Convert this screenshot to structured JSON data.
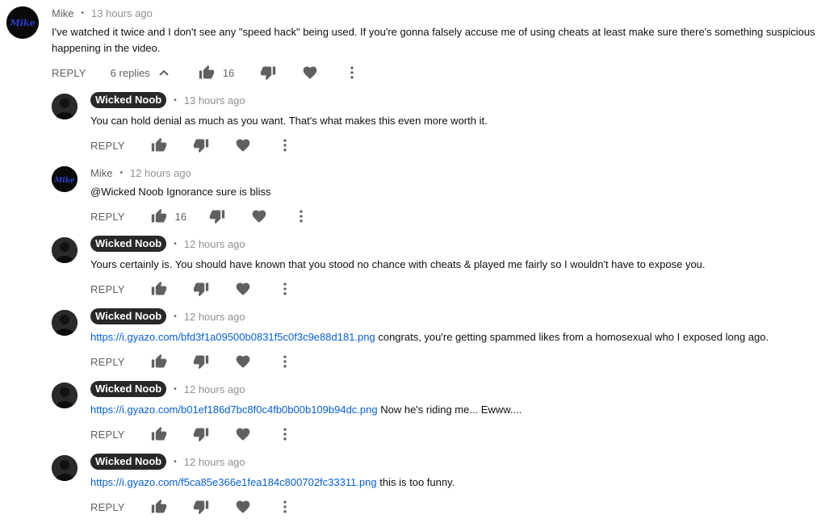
{
  "top_comment": {
    "author": "Mike",
    "time": "13 hours ago",
    "text": "I've watched it twice and I don't see any \"speed hack\" being used. If you're gonna falsely accuse me of using cheats at least make sure there's something suspicious happening in the video.",
    "reply_label": "REPLY",
    "replies_toggle": "6 replies",
    "likes": "16",
    "avatar_text": "Mike"
  },
  "replies": [
    {
      "author": "Wicked Noob",
      "time": "13 hours ago",
      "link": "",
      "text": "You can hold denial as much as you want. That's what makes this even more worth it.",
      "reply_label": "REPLY",
      "likes": ""
    },
    {
      "author": "Mike",
      "time": "12 hours ago",
      "link": "",
      "text": "@Wicked Noob Ignorance sure is bliss",
      "reply_label": "REPLY",
      "likes": "16",
      "avatar_text": "Mike"
    },
    {
      "author": "Wicked Noob",
      "time": "12 hours ago",
      "link": "",
      "text": "Yours certainly is. You should have known that you stood no chance with cheats & played me fairly so I wouldn't have to expose you.",
      "reply_label": "REPLY",
      "likes": ""
    },
    {
      "author": "Wicked Noob",
      "time": "12 hours ago",
      "link": "https://i.gyazo.com/bfd3f1a09500b0831f5c0f3c9e88d181.png",
      "text": " congrats, you're getting spammed likes from a homosexual who I exposed long ago.",
      "reply_label": "REPLY",
      "likes": ""
    },
    {
      "author": "Wicked Noob",
      "time": "12 hours ago",
      "link": "https://i.gyazo.com/b01ef186d7bc8f0c4fb0b00b109b94dc.png",
      "text": " Now he's riding me... Ewww....",
      "reply_label": "REPLY",
      "likes": ""
    },
    {
      "author": "Wicked Noob",
      "time": "12 hours ago",
      "link": "https://i.gyazo.com/f5ca85e366e1fea184c800702fc33311.png",
      "text": " this is too funny.",
      "reply_label": "REPLY",
      "likes": ""
    }
  ],
  "separator": "•",
  "colors": {
    "link": "#065fd4",
    "badge_bg": "#282828",
    "icon": "#606060",
    "mike_avatar_accent": "#2a3fd0"
  },
  "icons": [
    "thumbs-up-icon",
    "thumbs-down-icon",
    "heart-icon",
    "more-vert-icon",
    "chevron-up-icon"
  ]
}
